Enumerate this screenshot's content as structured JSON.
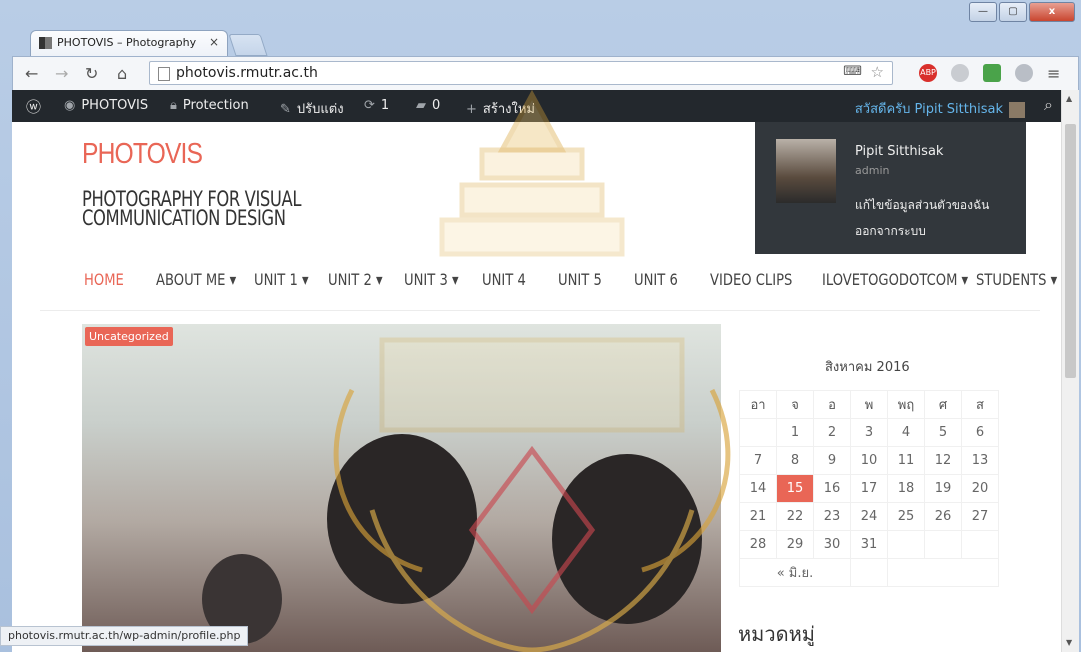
{
  "browser": {
    "tab_title": "PHOTOVIS – Photography",
    "tab_close": "×",
    "url": "photovis.rmutr.ac.th",
    "status_url": "photovis.rmutr.ac.th/wp-admin/profile.php",
    "ext_abp": "ABP",
    "win_minimize": "—",
    "win_maximize": "▢",
    "win_close": "x"
  },
  "adminbar": {
    "site": "PHOTOVIS",
    "protection": "Protection",
    "customize": "ปรับแต่ง",
    "updates": "1",
    "comments": "0",
    "new": "สร้างใหม่",
    "greeting": "สวัสดีครับ Pipit Sitthisak"
  },
  "dropdown": {
    "name": "Pipit Sitthisak",
    "role": "admin",
    "edit_profile": "แก้ไขข้อมูลส่วนตัวของฉัน",
    "logout": "ออกจากระบบ"
  },
  "site": {
    "title": "PHOTOVIS",
    "tagline": "PHOTOGRAPHY FOR VISUAL COMMUNICATION DESIGN"
  },
  "menu": [
    "HOME",
    "ABOUT ME ▾",
    "UNIT 1 ▾",
    "UNIT 2 ▾",
    "UNIT 3 ▾",
    "UNIT 4",
    "UNIT 5",
    "UNIT 6",
    "VIDEO CLIPS",
    "ILOVETOGODOTCOM ▾",
    "STUDENTS ▾"
  ],
  "post": {
    "category": "Uncategorized"
  },
  "calendar": {
    "caption": "สิงหาคม 2016",
    "headers": [
      "อา",
      "จ",
      "อ",
      "พ",
      "พฤ",
      "ศ",
      "ส"
    ],
    "rows": [
      [
        "",
        "1",
        "2",
        "3",
        "4",
        "5",
        "6"
      ],
      [
        "7",
        "8",
        "9",
        "10",
        "11",
        "12",
        "13"
      ],
      [
        "14",
        "15",
        "16",
        "17",
        "18",
        "19",
        "20"
      ],
      [
        "21",
        "22",
        "23",
        "24",
        "25",
        "26",
        "27"
      ],
      [
        "28",
        "29",
        "30",
        "31",
        "",
        "",
        ""
      ]
    ],
    "today": "15",
    "prev": "« มิ.ย."
  },
  "sidebar": {
    "categories_heading": "หมวดหมู่"
  },
  "colors": {
    "accent": "#e96656",
    "adminbar": "#23282d",
    "link": "#65b5ea"
  }
}
